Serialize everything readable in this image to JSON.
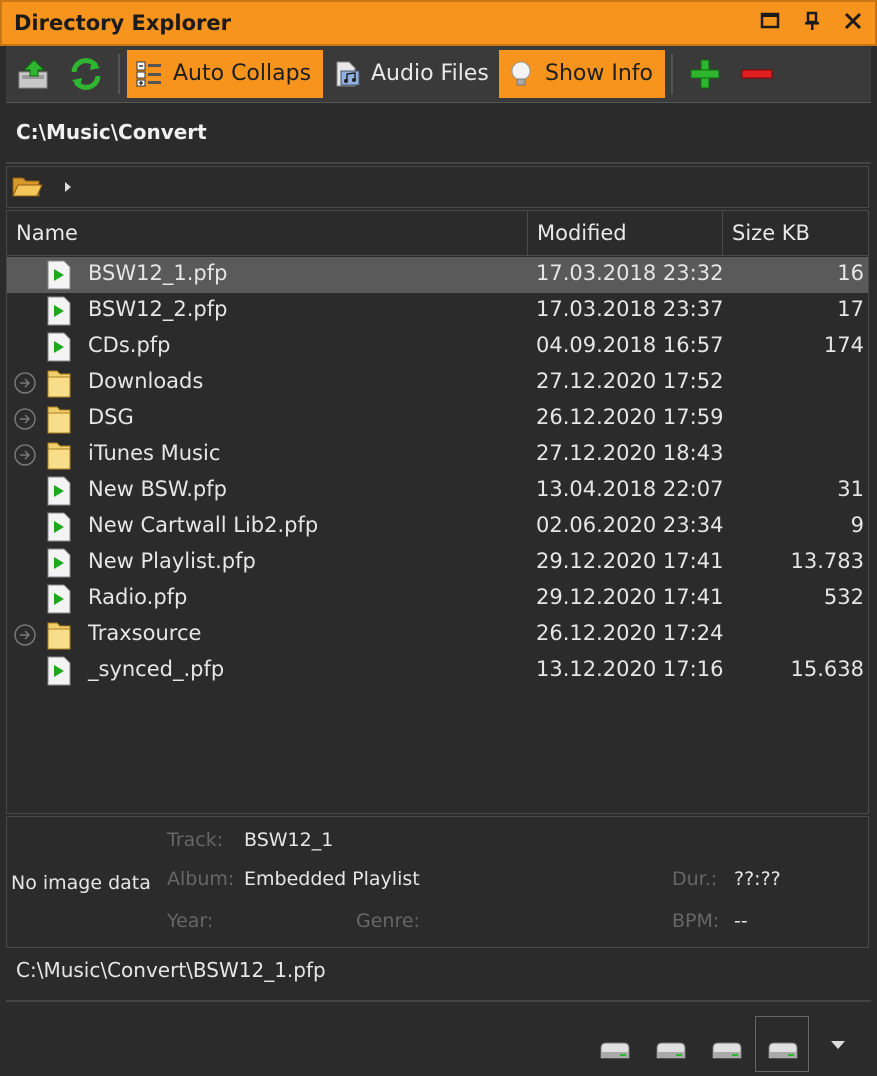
{
  "window": {
    "title": "Directory Explorer",
    "buttons": [
      {
        "name": "maximize-icon",
        "glyph": "□"
      },
      {
        "name": "pin-icon",
        "glyph": "⊥"
      },
      {
        "name": "close-icon",
        "glyph": "✕"
      }
    ]
  },
  "toolbar": {
    "auto_collapse": {
      "label": "Auto Collaps",
      "active": true
    },
    "audio_files": {
      "label": "Audio Files",
      "active": false
    },
    "show_info": {
      "label": "Show Info",
      "active": true
    }
  },
  "current_path": "C:\\Music\\Convert",
  "columns": {
    "name": "Name",
    "modified": "Modified",
    "size": "Size KB"
  },
  "rows": [
    {
      "type": "file",
      "name": "BSW12_1.pfp",
      "modified": "17.03.2018 23:32",
      "size": "16",
      "selected": true
    },
    {
      "type": "file",
      "name": "BSW12_2.pfp",
      "modified": "17.03.2018 23:37",
      "size": "17"
    },
    {
      "type": "file",
      "name": "CDs.pfp",
      "modified": "04.09.2018 16:57",
      "size": "174"
    },
    {
      "type": "folder",
      "name": "Downloads",
      "modified": "27.12.2020 17:52",
      "size": ""
    },
    {
      "type": "folder",
      "name": "DSG",
      "modified": "26.12.2020 17:59",
      "size": ""
    },
    {
      "type": "folder",
      "name": "iTunes Music",
      "modified": "27.12.2020 18:43",
      "size": ""
    },
    {
      "type": "file",
      "name": "New BSW.pfp",
      "modified": "13.04.2018 22:07",
      "size": "31"
    },
    {
      "type": "file",
      "name": "New Cartwall Lib2.pfp",
      "modified": "02.06.2020 23:34",
      "size": "9"
    },
    {
      "type": "file",
      "name": "New Playlist.pfp",
      "modified": "29.12.2020 17:41",
      "size": "13.783"
    },
    {
      "type": "file",
      "name": "Radio.pfp",
      "modified": "29.12.2020 17:41",
      "size": "532"
    },
    {
      "type": "folder",
      "name": "Traxsource",
      "modified": "26.12.2020 17:24",
      "size": ""
    },
    {
      "type": "file",
      "name": "_synced_.pfp",
      "modified": "13.12.2020 17:16",
      "size": "15.638"
    }
  ],
  "info": {
    "no_image": "No image data",
    "track_label": "Track:",
    "track_value": "BSW12_1",
    "album_label": "Album:",
    "album_value": "Embedded Playlist",
    "year_label": "Year:",
    "genre_label": "Genre:",
    "dur_label": "Dur.:",
    "dur_value": "??:??",
    "bpm_label": "BPM:",
    "bpm_value": "--"
  },
  "status_path": "C:\\Music\\Convert\\BSW12_1.pfp",
  "colors": {
    "accent": "#f7941d",
    "background": "#2b2b2b",
    "selection": "#5a5a5a"
  }
}
